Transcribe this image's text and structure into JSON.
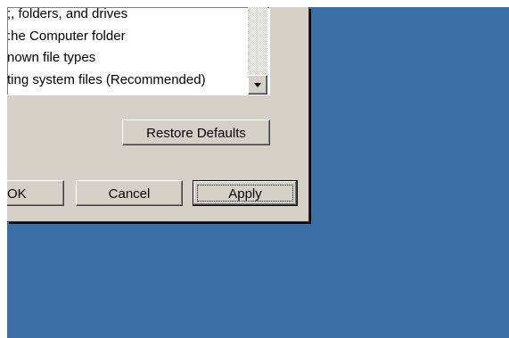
{
  "desktop": {
    "background_color": "#3a6ea5"
  },
  "dialog": {
    "list_items": [
      ";, folders, and drives",
      ":he Computer folder",
      "nown file types",
      "ting system files (Recommended)"
    ],
    "scroll_down_icon": "triangle-down",
    "restore_defaults_label": "Restore Defaults",
    "ok_label": "OK",
    "cancel_label": "Cancel",
    "apply_label": "Apply"
  }
}
